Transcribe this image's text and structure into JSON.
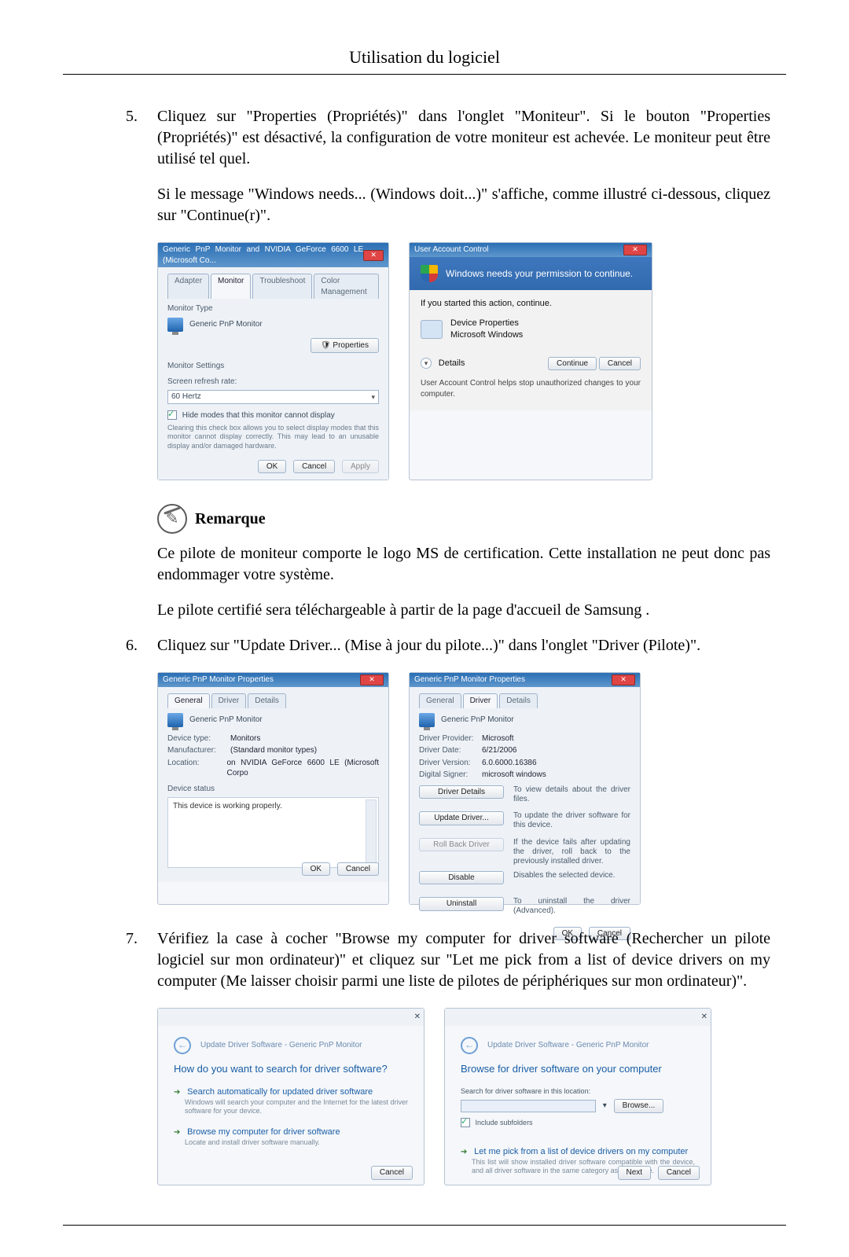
{
  "page": {
    "header": "Utilisation du logiciel"
  },
  "steps": {
    "s5num": "5.",
    "s5p1": "Cliquez sur \"Properties (Propriétés)\" dans l'onglet \"Moniteur\". Si le bouton \"Properties (Propriétés)\" est désactivé, la configuration de votre moniteur est achevée. Le moniteur peut être utilisé tel quel.",
    "s5p2": "Si le message \"Windows needs... (Windows doit...)\" s'affiche, comme illustré ci-dessous, cliquez sur \"Continue(r)\".",
    "s6num": "6.",
    "s6p1": "Cliquez sur \"Update Driver... (Mise à jour du pilote...)\" dans l'onglet \"Driver (Pilote)\".",
    "s7num": "7.",
    "s7p1": "Vérifiez la case à cocher \"Browse my computer for driver software (Rechercher un pilote logiciel sur mon ordinateur)\" et cliquez sur \"Let me pick from a list of device drivers on my computer (Me laisser choisir parmi une liste de pilotes de périphériques sur mon ordinateur)\"."
  },
  "note": {
    "title": "Remarque",
    "p1": "Ce pilote de moniteur comporte le logo MS de certification. Cette installation ne peut donc pas endommager votre système.",
    "p2": "Le pilote certifié sera téléchargeable à partir de la page d'accueil de Samsung ."
  },
  "dlg1": {
    "title": "Generic PnP Monitor and NVIDIA GeForce 6600 LE (Microsoft Co...",
    "tabs": {
      "adapter": "Adapter",
      "monitor": "Monitor",
      "troubleshoot": "Troubleshoot",
      "colormgmt": "Color Management"
    },
    "monitorType": "Monitor Type",
    "monitorName": "Generic PnP Monitor",
    "propertiesBtn": "Properties",
    "monitorSettings": "Monitor Settings",
    "refreshLabel": "Screen refresh rate:",
    "refreshValue": "60 Hertz",
    "hideModes": "Hide modes that this monitor cannot display",
    "hideHelp": "Clearing this check box allows you to select display modes that this monitor cannot display correctly. This may lead to an unusable display and/or damaged hardware.",
    "ok": "OK",
    "cancel": "Cancel",
    "apply": "Apply"
  },
  "uac": {
    "title": "User Account Control",
    "headline": "Windows needs your permission to continue.",
    "ifYouStarted": "If you started this action, continue.",
    "devProps": "Device Properties",
    "ms": "Microsoft Windows",
    "details": "Details",
    "continue": "Continue",
    "cancel": "Cancel",
    "foot": "User Account Control helps stop unauthorized changes to your computer."
  },
  "prop_general": {
    "title": "Generic PnP Monitor Properties",
    "tabs": {
      "general": "General",
      "driver": "Driver",
      "details": "Details"
    },
    "monitorName": "Generic PnP Monitor",
    "devtype_k": "Device type:",
    "devtype_v": "Monitors",
    "manu_k": "Manufacturer:",
    "manu_v": "(Standard monitor types)",
    "loc_k": "Location:",
    "loc_v": "on NVIDIA GeForce 6600 LE (Microsoft Corpo",
    "statusLabel": "Device status",
    "statusText": "This device is working properly.",
    "ok": "OK",
    "cancel": "Cancel"
  },
  "prop_driver": {
    "title": "Generic PnP Monitor Properties",
    "tabs": {
      "general": "General",
      "driver": "Driver",
      "details": "Details"
    },
    "monitorName": "Generic PnP Monitor",
    "prov_k": "Driver Provider:",
    "prov_v": "Microsoft",
    "date_k": "Driver Date:",
    "date_v": "6/21/2006",
    "ver_k": "Driver Version:",
    "ver_v": "6.0.6000.16386",
    "sign_k": "Digital Signer:",
    "sign_v": "microsoft windows",
    "b_details": "Driver Details",
    "b_details_d": "To view details about the driver files.",
    "b_update": "Update Driver...",
    "b_update_d": "To update the driver software for this device.",
    "b_rollback": "Roll Back Driver",
    "b_rollback_d": "If the device fails after updating the driver, roll back to the previously installed driver.",
    "b_disable": "Disable",
    "b_disable_d": "Disables the selected device.",
    "b_uninstall": "Uninstall",
    "b_uninstall_d": "To uninstall the driver (Advanced).",
    "ok": "OK",
    "cancel": "Cancel"
  },
  "wiz1": {
    "breadcrumb": "Update Driver Software - Generic PnP Monitor",
    "question": "How do you want to search for driver software?",
    "opt1_t": "Search automatically for updated driver software",
    "opt1_d": "Windows will search your computer and the Internet for the latest driver software for your device.",
    "opt2_t": "Browse my computer for driver software",
    "opt2_d": "Locate and install driver software manually.",
    "cancel": "Cancel"
  },
  "wiz2": {
    "breadcrumb": "Update Driver Software - Generic PnP Monitor",
    "heading": "Browse for driver software on your computer",
    "searchLabel": "Search for driver software in this location:",
    "browse": "Browse...",
    "includeSub": "Include subfolders",
    "opt_t": "Let me pick from a list of device drivers on my computer",
    "opt_d": "This list will show installed driver software compatible with the device, and all driver software in the same category as the device.",
    "next": "Next",
    "cancel": "Cancel"
  }
}
